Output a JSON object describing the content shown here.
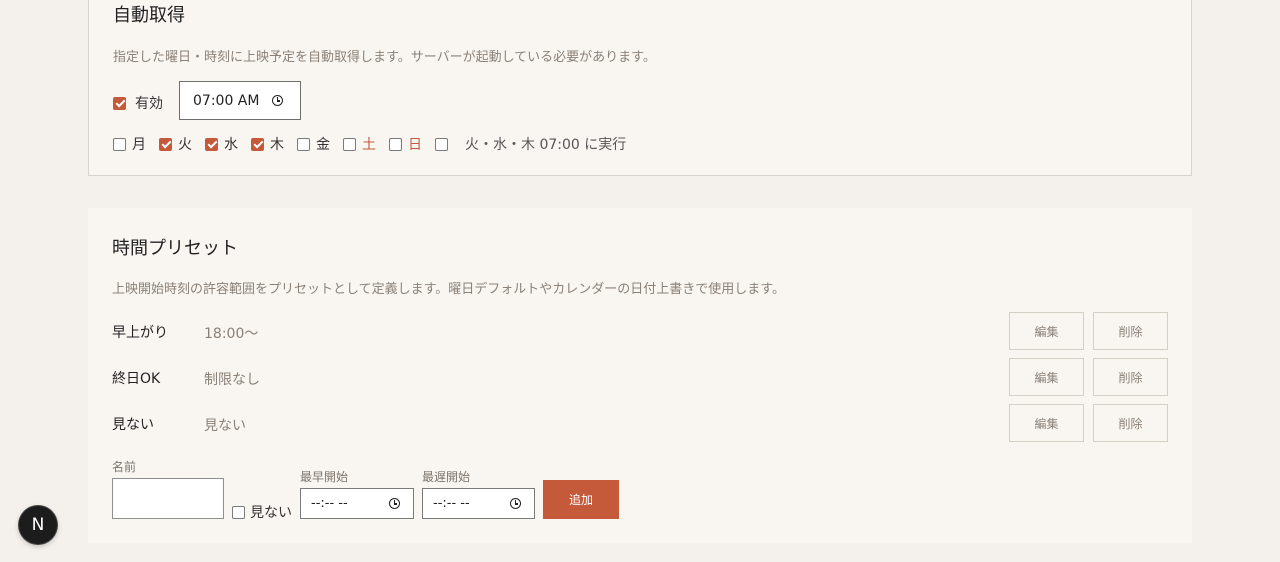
{
  "auto_fetch": {
    "title": "自動取得",
    "description": "指定した曜日・時刻に上映予定を自動取得します。サーバーが起動している必要があります。",
    "enabled_label": "有効",
    "enabled": true,
    "time_value": "07:00 AM",
    "days": [
      {
        "label": "月",
        "checked": false
      },
      {
        "label": "火",
        "checked": true
      },
      {
        "label": "水",
        "checked": true
      },
      {
        "label": "木",
        "checked": true
      },
      {
        "label": "金",
        "checked": false
      },
      {
        "label": "土",
        "checked": false
      },
      {
        "label": "日",
        "checked": false
      }
    ],
    "extra_checkbox_checked": false,
    "schedule_summary": "火・水・木 07:00 に実行"
  },
  "presets": {
    "title": "時間プリセット",
    "description": "上映開始時刻の許容範囲をプリセットとして定義します。曜日デフォルトやカレンダーの日付上書きで使用します。",
    "items": [
      {
        "name": "早上がり",
        "range": "18:00〜"
      },
      {
        "name": "終日OK",
        "range": "制限なし"
      },
      {
        "name": "見ない",
        "range": "見ない"
      }
    ],
    "edit_label": "編集",
    "delete_label": "削除",
    "form": {
      "name_label": "名前",
      "hide_label": "見ない",
      "earliest_label": "最早開始",
      "latest_label": "最遅開始",
      "time_placeholder": "--:-- --",
      "add_label": "追加"
    }
  },
  "badge": {
    "letter": "N"
  },
  "colors": {
    "accent": "#c55a3b",
    "background": "#f4f1ec",
    "card": "#f9f6f2"
  }
}
